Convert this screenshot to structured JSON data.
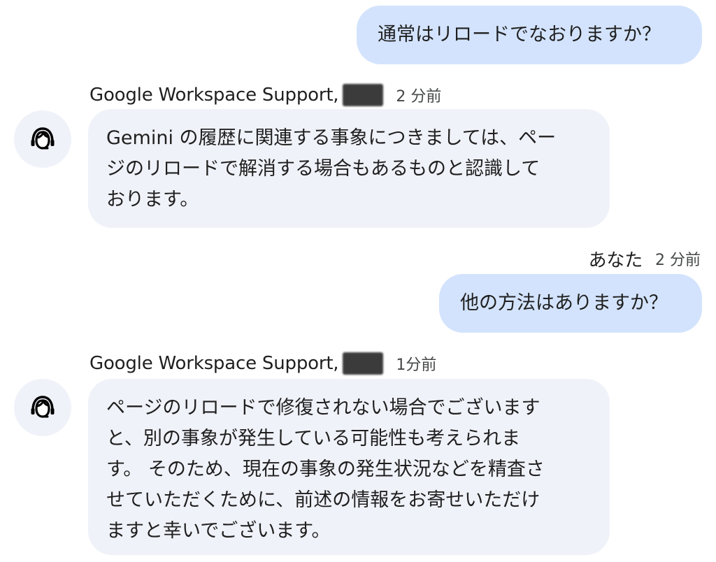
{
  "messages": {
    "user_1": {
      "text": "通常はリロードでなおりますか？"
    },
    "agent_1": {
      "sender": "Google Workspace Support,",
      "time": "2 分前",
      "lines": [
        "Gemini の履歴に関連する事象につきましては、ペー",
        "ジのリロードで解消する場合もあるものと認識して",
        "おります。"
      ]
    },
    "user_2": {
      "sender": "あなた",
      "time": "2 分前",
      "text": "他の方法はありますか？"
    },
    "agent_2": {
      "sender": "Google Workspace Support,",
      "time": "1分前",
      "lines": [
        "ページのリロードで修復されない場合でございます",
        "と、別の事象が発生している可能性も考えられま",
        "す。 そのため、現在の事象の発生状況などを精査さ",
        "せていただくために、前述の情報をお寄せいただけ",
        "ますと幸いでございます。"
      ]
    }
  },
  "icons": {
    "agent_avatar": "support-agent-icon",
    "redaction": "redacted-name-mark"
  },
  "colors": {
    "user_bubble": "#d3e3fd",
    "agent_bubble": "#f0f2f9",
    "text": "#1f1f1f",
    "time": "#444746"
  }
}
